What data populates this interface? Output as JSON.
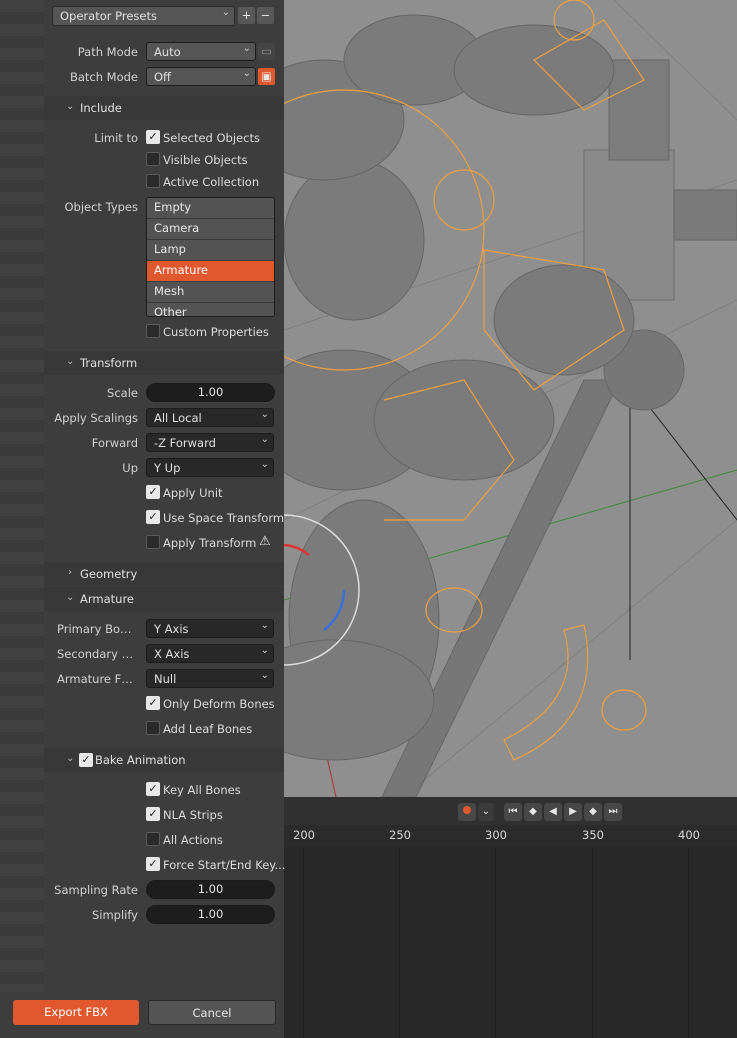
{
  "dialog": {
    "operator_presets": "Operator Presets",
    "path_mode": {
      "label": "Path Mode",
      "value": "Auto"
    },
    "batch_mode": {
      "label": "Batch Mode",
      "value": "Off"
    },
    "include": {
      "title": "Include",
      "limit_to_label": "Limit to",
      "selected_objects": "Selected Objects",
      "visible_objects": "Visible Objects",
      "active_collection": "Active Collection",
      "object_types_label": "Object Types",
      "object_types": [
        "Empty",
        "Camera",
        "Lamp",
        "Armature",
        "Mesh",
        "Other"
      ],
      "selected_type": "Armature",
      "custom_properties": "Custom Properties"
    },
    "transform": {
      "title": "Transform",
      "scale_label": "Scale",
      "scale": "1.00",
      "apply_scalings_label": "Apply Scalings",
      "apply_scalings": "All Local",
      "forward_label": "Forward",
      "forward": "-Z Forward",
      "up_label": "Up",
      "up": "Y Up",
      "apply_unit": "Apply Unit",
      "use_space_transform": "Use Space Transform",
      "apply_transform": "Apply Transform"
    },
    "geometry": {
      "title": "Geometry"
    },
    "armature": {
      "title": "Armature",
      "primary_bone_label": "Primary Bone ...",
      "primary_bone": "Y Axis",
      "secondary_bone_label": "Secondary Bo...",
      "secondary_bone": "X Axis",
      "armature_fbx_label": "Armature FBX...",
      "armature_fbx": "Null",
      "only_deform_bones": "Only Deform Bones",
      "add_leaf_bones": "Add Leaf Bones"
    },
    "bake_animation": {
      "title": "Bake Animation",
      "key_all_bones": "Key All Bones",
      "nla_strips": "NLA Strips",
      "all_actions": "All Actions",
      "force_start_end": "Force Start/End Key...",
      "sampling_rate_label": "Sampling Rate",
      "sampling_rate": "1.00",
      "simplify_label": "Simplify",
      "simplify": "1.00"
    },
    "export_button": "Export FBX",
    "cancel_button": "Cancel"
  },
  "timeline": {
    "frames": [
      "200",
      "250",
      "300",
      "350",
      "400"
    ]
  },
  "colors": {
    "accent": "#e1582e",
    "panel": "#3d3d3d",
    "viewport": "#8f8f8f"
  }
}
